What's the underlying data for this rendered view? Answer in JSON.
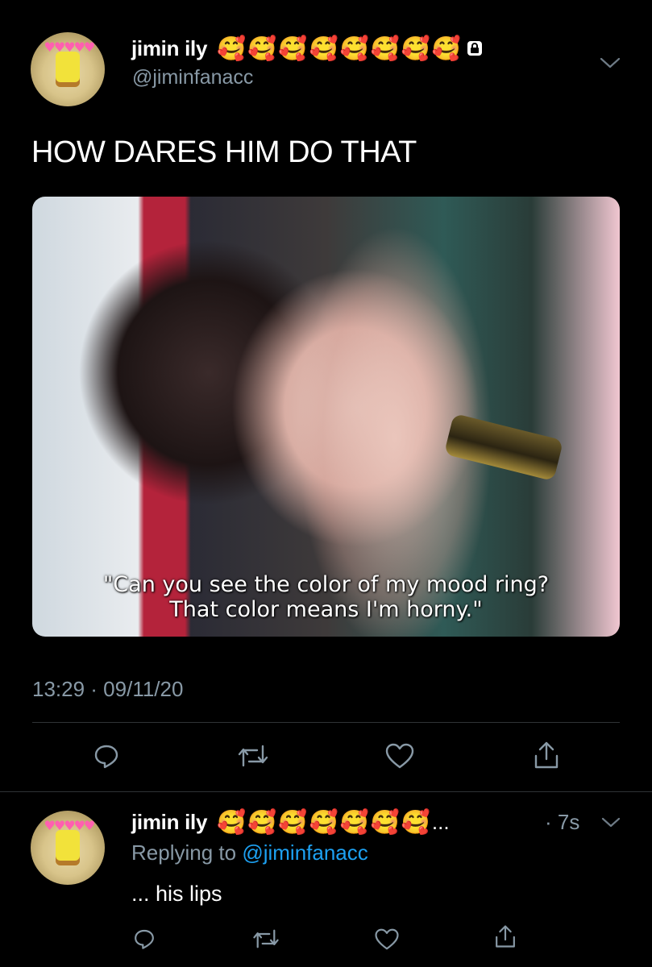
{
  "tweet": {
    "display_name": "jimin ily",
    "emojis": [
      "🥰",
      "🥰",
      "🥰",
      "🥰",
      "🥰",
      "🥰",
      "🥰",
      "🥰"
    ],
    "handle": "@jiminfanacc",
    "text": "HOW DARES HIM DO THAT",
    "media_caption_line1": "\"Can you see the color of my mood ring?",
    "media_caption_line2": "That color means I'm horny.\"",
    "timestamp": "13:29 · 09/11/20"
  },
  "reply": {
    "display_name": "jimin ily",
    "emojis": [
      "🥰",
      "🥰",
      "🥰",
      "🥰",
      "🥰",
      "🥰",
      "🥰"
    ],
    "ellipsis": "...",
    "time": "· 7s",
    "replying_prefix": "Replying to",
    "replying_handle": "@jiminfanacc",
    "text": "... his lips"
  },
  "icons": {
    "lock": "lock-icon",
    "chevron": "chevron-down-icon",
    "reply": "reply-icon",
    "retweet": "retweet-icon",
    "like": "heart-icon",
    "share": "share-icon"
  },
  "colors": {
    "background": "#000000",
    "muted": "#8899a6",
    "link": "#1da1f2",
    "divider": "#2f3336"
  }
}
